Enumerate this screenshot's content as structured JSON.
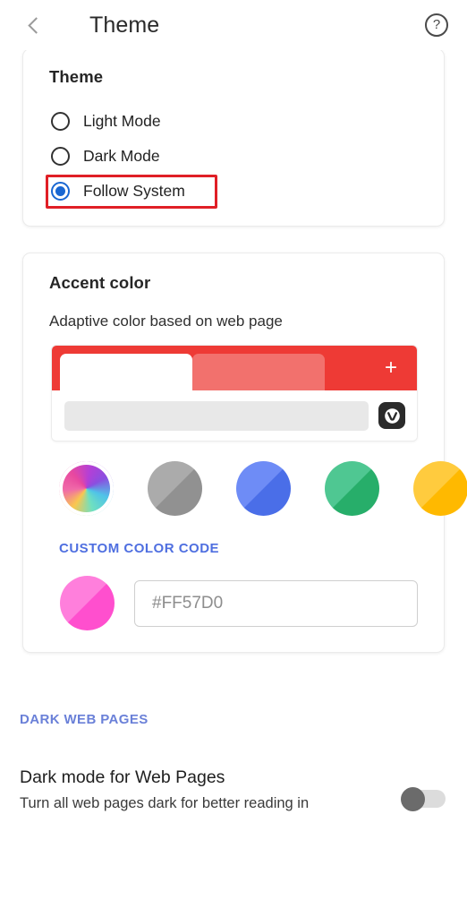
{
  "header": {
    "back_icon": "chevron-left-icon",
    "title": "Theme",
    "help_icon": "help-circle-icon",
    "help_glyph": "?"
  },
  "theme_card": {
    "title": "Theme",
    "options": [
      {
        "label": "Light Mode",
        "selected": false
      },
      {
        "label": "Dark Mode",
        "selected": false
      },
      {
        "label": "Follow System",
        "selected": true,
        "highlighted": true
      }
    ],
    "highlight_color": "#E01F26"
  },
  "accent_card": {
    "title": "Accent color",
    "subtitle": "Adaptive color based on web page",
    "preview": {
      "accent_color": "#EE3A35",
      "inactive_tab_color": "#F2716D",
      "new_tab_icon": "plus-icon",
      "new_tab_glyph": "+",
      "address_placeholder": "",
      "logo_icon": "vivaldi-logo-icon"
    },
    "swatches": [
      {
        "name": "adaptive",
        "selected": true,
        "top": "#7ED8E8",
        "bottom": "#E84FB4"
      },
      {
        "name": "gray",
        "selected": false,
        "top": "#ABABAB",
        "bottom": "#919191"
      },
      {
        "name": "blue",
        "selected": false,
        "top": "#6E8CF6",
        "bottom": "#4A6EE8"
      },
      {
        "name": "green",
        "selected": false,
        "top": "#4FC792",
        "bottom": "#27AE6A"
      },
      {
        "name": "yellow",
        "selected": false,
        "top": "#FFCB3E",
        "bottom": "#FFB900"
      }
    ],
    "custom_color": {
      "label": "CUSTOM COLOR CODE",
      "label_color": "#4F6FE0",
      "swatch_top": "#FF7FDC",
      "swatch_bottom": "#FF4FCE",
      "input_value": "",
      "input_placeholder": "#FF57D0"
    }
  },
  "dark_web_pages": {
    "section_label": "DARK WEB PAGES",
    "section_label_color": "#6A80D8",
    "pref_title": "Dark mode for Web Pages",
    "pref_description": "Turn all web pages dark for better reading in",
    "toggle_on": false
  }
}
